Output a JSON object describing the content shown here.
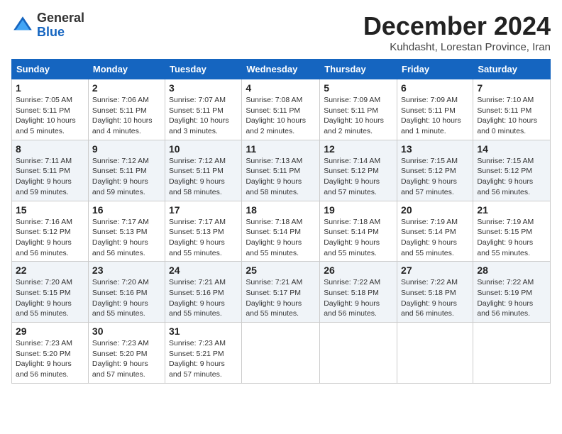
{
  "logo": {
    "line1": "General",
    "line2": "Blue"
  },
  "title": "December 2024",
  "subtitle": "Kuhdasht, Lorestan Province, Iran",
  "headers": [
    "Sunday",
    "Monday",
    "Tuesday",
    "Wednesday",
    "Thursday",
    "Friday",
    "Saturday"
  ],
  "weeks": [
    [
      {
        "day": "1",
        "rise": "7:05 AM",
        "set": "5:11 PM",
        "daylight": "10 hours and 5 minutes."
      },
      {
        "day": "2",
        "rise": "7:06 AM",
        "set": "5:11 PM",
        "daylight": "10 hours and 4 minutes."
      },
      {
        "day": "3",
        "rise": "7:07 AM",
        "set": "5:11 PM",
        "daylight": "10 hours and 3 minutes."
      },
      {
        "day": "4",
        "rise": "7:08 AM",
        "set": "5:11 PM",
        "daylight": "10 hours and 2 minutes."
      },
      {
        "day": "5",
        "rise": "7:09 AM",
        "set": "5:11 PM",
        "daylight": "10 hours and 2 minutes."
      },
      {
        "day": "6",
        "rise": "7:09 AM",
        "set": "5:11 PM",
        "daylight": "10 hours and 1 minute."
      },
      {
        "day": "7",
        "rise": "7:10 AM",
        "set": "5:11 PM",
        "daylight": "10 hours and 0 minutes."
      }
    ],
    [
      {
        "day": "8",
        "rise": "7:11 AM",
        "set": "5:11 PM",
        "daylight": "9 hours and 59 minutes."
      },
      {
        "day": "9",
        "rise": "7:12 AM",
        "set": "5:11 PM",
        "daylight": "9 hours and 59 minutes."
      },
      {
        "day": "10",
        "rise": "7:12 AM",
        "set": "5:11 PM",
        "daylight": "9 hours and 58 minutes."
      },
      {
        "day": "11",
        "rise": "7:13 AM",
        "set": "5:11 PM",
        "daylight": "9 hours and 58 minutes."
      },
      {
        "day": "12",
        "rise": "7:14 AM",
        "set": "5:12 PM",
        "daylight": "9 hours and 57 minutes."
      },
      {
        "day": "13",
        "rise": "7:15 AM",
        "set": "5:12 PM",
        "daylight": "9 hours and 57 minutes."
      },
      {
        "day": "14",
        "rise": "7:15 AM",
        "set": "5:12 PM",
        "daylight": "9 hours and 56 minutes."
      }
    ],
    [
      {
        "day": "15",
        "rise": "7:16 AM",
        "set": "5:12 PM",
        "daylight": "9 hours and 56 minutes."
      },
      {
        "day": "16",
        "rise": "7:17 AM",
        "set": "5:13 PM",
        "daylight": "9 hours and 56 minutes."
      },
      {
        "day": "17",
        "rise": "7:17 AM",
        "set": "5:13 PM",
        "daylight": "9 hours and 55 minutes."
      },
      {
        "day": "18",
        "rise": "7:18 AM",
        "set": "5:14 PM",
        "daylight": "9 hours and 55 minutes."
      },
      {
        "day": "19",
        "rise": "7:18 AM",
        "set": "5:14 PM",
        "daylight": "9 hours and 55 minutes."
      },
      {
        "day": "20",
        "rise": "7:19 AM",
        "set": "5:14 PM",
        "daylight": "9 hours and 55 minutes."
      },
      {
        "day": "21",
        "rise": "7:19 AM",
        "set": "5:15 PM",
        "daylight": "9 hours and 55 minutes."
      }
    ],
    [
      {
        "day": "22",
        "rise": "7:20 AM",
        "set": "5:15 PM",
        "daylight": "9 hours and 55 minutes."
      },
      {
        "day": "23",
        "rise": "7:20 AM",
        "set": "5:16 PM",
        "daylight": "9 hours and 55 minutes."
      },
      {
        "day": "24",
        "rise": "7:21 AM",
        "set": "5:16 PM",
        "daylight": "9 hours and 55 minutes."
      },
      {
        "day": "25",
        "rise": "7:21 AM",
        "set": "5:17 PM",
        "daylight": "9 hours and 55 minutes."
      },
      {
        "day": "26",
        "rise": "7:22 AM",
        "set": "5:18 PM",
        "daylight": "9 hours and 56 minutes."
      },
      {
        "day": "27",
        "rise": "7:22 AM",
        "set": "5:18 PM",
        "daylight": "9 hours and 56 minutes."
      },
      {
        "day": "28",
        "rise": "7:22 AM",
        "set": "5:19 PM",
        "daylight": "9 hours and 56 minutes."
      }
    ],
    [
      {
        "day": "29",
        "rise": "7:23 AM",
        "set": "5:20 PM",
        "daylight": "9 hours and 56 minutes."
      },
      {
        "day": "30",
        "rise": "7:23 AM",
        "set": "5:20 PM",
        "daylight": "9 hours and 57 minutes."
      },
      {
        "day": "31",
        "rise": "7:23 AM",
        "set": "5:21 PM",
        "daylight": "9 hours and 57 minutes."
      },
      null,
      null,
      null,
      null
    ]
  ]
}
